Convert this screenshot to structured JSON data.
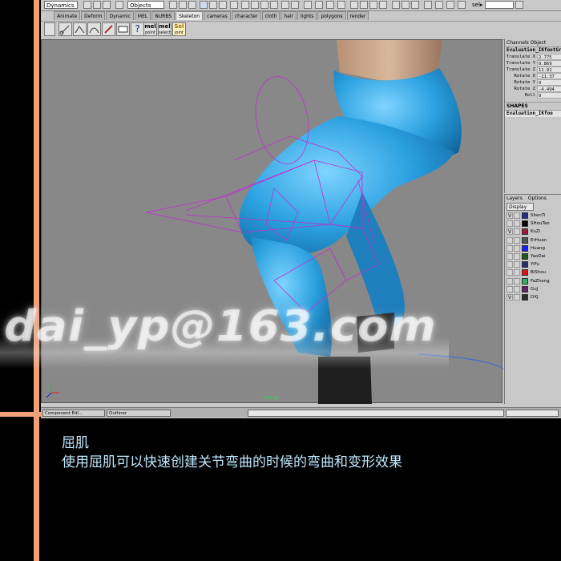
{
  "toolbar": {
    "mode_menu": "Dynamics",
    "selection_mask": "Objects",
    "sel_field_label": "sel▸"
  },
  "shelf_tabs": [
    "Animate",
    "Deform",
    "Dynamic",
    "MEL",
    "NURBS",
    "Skeleton",
    "cameras",
    "character",
    "cloth",
    "hair",
    "lights",
    "polygons",
    "render"
  ],
  "active_shelf_tab": "Skeleton",
  "shelf_buttons": [
    "joint-tool",
    "ik-handle",
    "ik-spline",
    "paint-weights",
    "smooth-bind",
    "help",
    "mel",
    "mel",
    "sel"
  ],
  "shelf_button_labels": {
    "mel1": "mel",
    "mel1_sub": "point",
    "mel2": "mel",
    "mel2_sub": "select",
    "sel": "Sel",
    "sel_sub": "joint"
  },
  "channel_box": {
    "header": "Channels  Object",
    "node": "Evaluation_IKfootGr",
    "attributes": [
      {
        "name": "Translate X",
        "value": "2.775"
      },
      {
        "name": "Translate Y",
        "value": "0.869"
      },
      {
        "name": "Translate Z",
        "value": "11.91"
      },
      {
        "name": "Rotate X",
        "value": "-11.37"
      },
      {
        "name": "Rotate Y",
        "value": "0"
      },
      {
        "name": "Rotate Z",
        "value": "-4.494"
      },
      {
        "name": "Roll",
        "value": "0"
      }
    ],
    "shapes_label": "SHAPES",
    "shape_node": "Evaluation_IKfoo"
  },
  "layers": {
    "menu": [
      "Layers",
      "Options"
    ],
    "display_menu": "Display",
    "items": [
      {
        "name": "ShenTi",
        "visible": "V",
        "color": "#2a2a8c"
      },
      {
        "name": "SHouTao",
        "visible": "",
        "color": "#000000"
      },
      {
        "name": "KuZi",
        "visible": "V",
        "color": "#a01a3c"
      },
      {
        "name": "ErHuan",
        "visible": "",
        "color": "#555555"
      },
      {
        "name": "Huang",
        "visible": "",
        "color": "#1a1aff"
      },
      {
        "name": "YaoDai",
        "visible": "",
        "color": "#1a5a1a"
      },
      {
        "name": "YiFu",
        "visible": "",
        "color": "#2a2a6a"
      },
      {
        "name": "BiShou",
        "visible": "",
        "color": "#e01010"
      },
      {
        "name": "FaZhang",
        "visible": "",
        "color": "#2ab060"
      },
      {
        "name": "GuJ",
        "visible": "",
        "color": "#6a1a6a"
      },
      {
        "name": "DXJ",
        "visible": "V",
        "color": "#2a2a2a"
      }
    ]
  },
  "viewport": {
    "camera_label": "persp"
  },
  "bottom_bar": {
    "component_editor": "Component Edi...",
    "outliner": "Outliner"
  },
  "watermark": "dai_yp@163.com",
  "caption": {
    "title": "屈肌",
    "description": "使用屈肌可以快速创建关节弯曲的时候的弯曲和变形效果"
  }
}
